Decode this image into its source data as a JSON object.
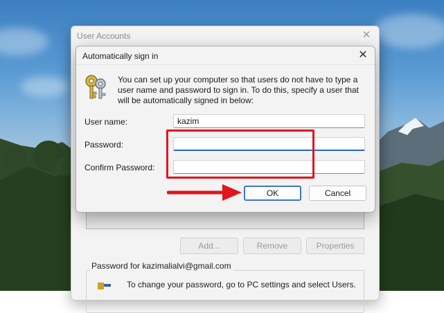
{
  "background_window": {
    "title": "User Accounts",
    "buttons": {
      "add": "Add...",
      "remove": "Remove",
      "properties": "Properties"
    },
    "password_group_label": "Password for kazimalialvi@gmail.com",
    "password_info": "To change your password, go to PC settings and select Users."
  },
  "dialog": {
    "title": "Automatically sign in",
    "description": "You can set up your computer so that users do not have to type a user name and password to sign in. To do this, specify a user that will be automatically signed in below:",
    "fields": {
      "user_name": {
        "label": "User name:",
        "value": "kazim"
      },
      "password": {
        "label": "Password:",
        "value": ""
      },
      "confirm_password": {
        "label": "Confirm Password:",
        "value": ""
      }
    },
    "buttons": {
      "ok": "OK",
      "cancel": "Cancel"
    }
  },
  "colors": {
    "annotation": "#e2141c",
    "focus_accent": "#2a63c6",
    "default_button_border": "#3a76cf"
  },
  "icons": [
    "close-icon",
    "keys-icon"
  ]
}
